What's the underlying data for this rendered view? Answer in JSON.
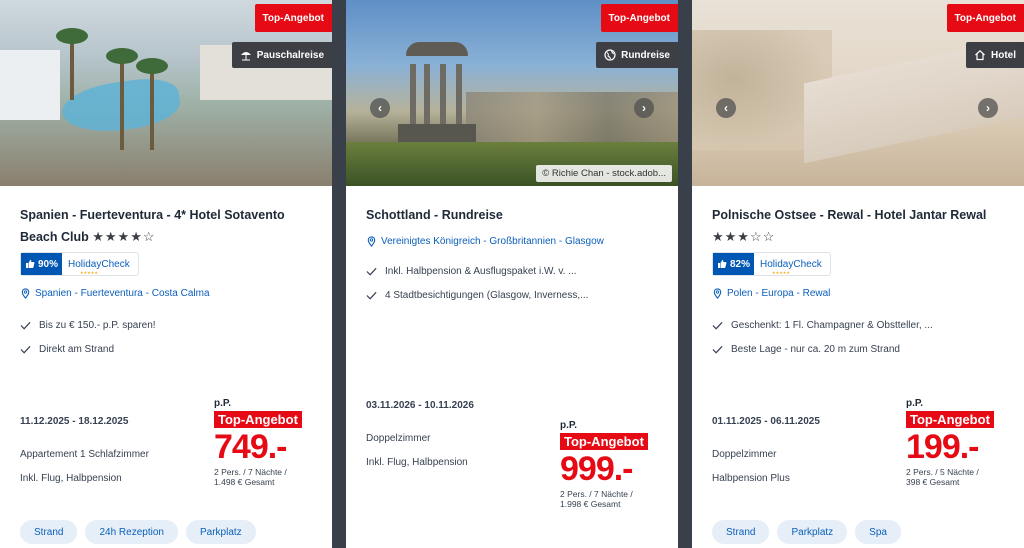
{
  "cards": [
    {
      "badge_top": "Top-Angebot",
      "badge_type": "Pauschalreise",
      "title": "Spanien - Fuerteventura - 4* Hotel Sotavento Beach Club",
      "stars": "★★★★☆",
      "holidaycheck": {
        "score": "90%",
        "label": "HolidayCheck"
      },
      "location": "Spanien - Fuerteventura - Costa Calma",
      "features": [
        "Bis zu € 150.- p.P. sparen!",
        "Direkt am Strand"
      ],
      "dates": "11.12.2025 - 18.12.2025",
      "room": "Appartement 1 Schlafzimmer",
      "board": "Inkl. Flug, Halbpension",
      "price": {
        "pp": "p.P.",
        "tag": "Top-Angebot",
        "amount": "749.-",
        "line1": "2 Pers. / 7 Nächte /",
        "line2": "1.498 € Gesamt"
      },
      "chips": [
        "Strand",
        "24h Rezeption",
        "Parkplatz"
      ]
    },
    {
      "badge_top": "Top-Angebot",
      "badge_type": "Rundreise",
      "credit": "© Richie Chan - stock.adob...",
      "title": "Schottland - Rundreise",
      "location": "Vereinigtes Königreich - Großbritannien - Glasgow",
      "features": [
        "Inkl. Halbpension & Ausflugspaket i.W. v. ...",
        "4 Stadtbesichtigungen (Glasgow, Inverness,..."
      ],
      "dates": "03.11.2026 - 10.11.2026",
      "room": "Doppelzimmer",
      "board": "Inkl. Flug, Halbpension",
      "price": {
        "pp": "p.P.",
        "tag": "Top-Angebot",
        "amount": "999.-",
        "line1": "2 Pers. / 7 Nächte /",
        "line2": "1.998 € Gesamt"
      }
    },
    {
      "badge_top": "Top-Angebot",
      "badge_type": "Hotel",
      "title": "Polnische Ostsee - Rewal - Hotel Jantar Rewal",
      "stars": "★★★☆☆",
      "holidaycheck": {
        "score": "82%",
        "label": "HolidayCheck"
      },
      "location": "Polen - Europa - Rewal",
      "features": [
        "Geschenkt: 1 Fl. Champagner & Obstteller, ...",
        "Beste Lage - nur ca. 20 m zum Strand"
      ],
      "dates": "01.11.2025 - 06.11.2025",
      "room": "Doppelzimmer",
      "board": "Halbpension Plus",
      "price": {
        "pp": "p.P.",
        "tag": "Top-Angebot",
        "amount": "199.-",
        "line1": "2 Pers. / 5 Nächte /",
        "line2": "398 € Gesamt"
      },
      "chips": [
        "Strand",
        "Parkplatz",
        "Spa"
      ]
    }
  ],
  "colors": {
    "accent": "#e60a14",
    "link": "#0b5fbb",
    "chip_bg": "#e6eef8",
    "dark_badge": "#3d3f44"
  },
  "icons": {
    "location": "map-pin-icon",
    "feature": "checkmark-icon",
    "thumb": "thumbs-up-icon",
    "nav_prev": "chevron-left-icon",
    "nav_next": "chevron-right-icon"
  }
}
